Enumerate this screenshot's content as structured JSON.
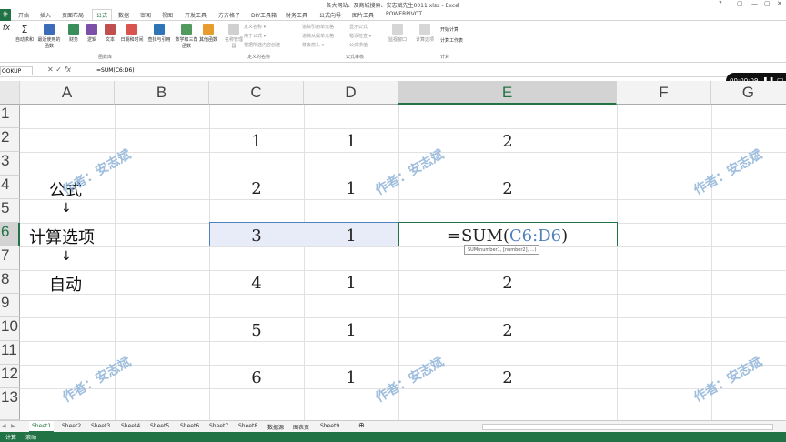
{
  "window": {
    "title": "各大网站、及商城搜索、安志斌先生0011.xlsx - Excel",
    "controls": [
      "?",
      "▢",
      "—",
      "▢",
      "✕"
    ]
  },
  "ribbon_tabs": {
    "file": "件",
    "tabs": [
      "开始",
      "插入",
      "页面布局",
      "公式",
      "数据",
      "审阅",
      "视图",
      "开发工具",
      "方方格子",
      "DIY工具箱",
      "财务工具",
      "公式向导",
      "图片工具",
      "POWERPIVOT"
    ]
  },
  "ribbon": {
    "buttons": [
      "fx",
      "自动求和",
      "最近使用的函数",
      "财务",
      "逻辑",
      "文本",
      "日期和时间",
      "查找与引用",
      "数学和三角函数",
      "其他函数",
      "名称管理器",
      "监视窗口",
      "计算选项"
    ],
    "small": [
      "定义名称 ▾",
      "用于公式 ▾",
      "根据所选内容创建",
      "追踪引用单元格",
      "追踪从属单元格",
      "移去箭头 ▾",
      "显示公式",
      "错误检查 ▾",
      "公式求值",
      "开始计算",
      "计算工作表"
    ],
    "groups": [
      "函数库",
      "定义的名称",
      "公式审核",
      "计算"
    ]
  },
  "formula_bar": {
    "name_box": "OOKUP",
    "formula": "=SUM(C6:D6)"
  },
  "columns": [
    "A",
    "B",
    "C",
    "D",
    "E",
    "F",
    "G"
  ],
  "rows": [
    "1",
    "2",
    "3",
    "4",
    "5",
    "6",
    "7",
    "8",
    "9",
    "10",
    "11",
    "12",
    "13"
  ],
  "cells": {
    "C2": "1",
    "D2": "1",
    "E2": "2",
    "C4": "2",
    "D4": "1",
    "E4": "2",
    "C6": "3",
    "D6": "1",
    "C8": "4",
    "D8": "1",
    "E8": "2",
    "C10": "5",
    "D10": "1",
    "E10": "2",
    "C12": "6",
    "D12": "1",
    "E12": "2"
  },
  "labels": {
    "a4": "公式",
    "a6": "计算选项",
    "a8": "自动",
    "arrow": "↓"
  },
  "edit_cell": {
    "prefix": "=SUM(",
    "ref": "C6:D6",
    "suffix": ")"
  },
  "tooltip": "SUM(number1, [number2], ...)",
  "watermark": "作者：安志斌",
  "sheets": [
    "Sheet1",
    "Sheet2",
    "Sheet3",
    "Sheet4",
    "Sheet5",
    "Sheet6",
    "Sheet7",
    "Sheet8",
    "数据源",
    "图表页",
    "Sheet9"
  ],
  "status": {
    "left": "计算",
    "mode": "滚动"
  },
  "player": {
    "time": "00:00:09",
    "controls": "❚❚ ▢"
  },
  "colors": {
    "accent": "#217346",
    "ref_blue": "#4f81bd",
    "selection": "#e8ecf8"
  }
}
